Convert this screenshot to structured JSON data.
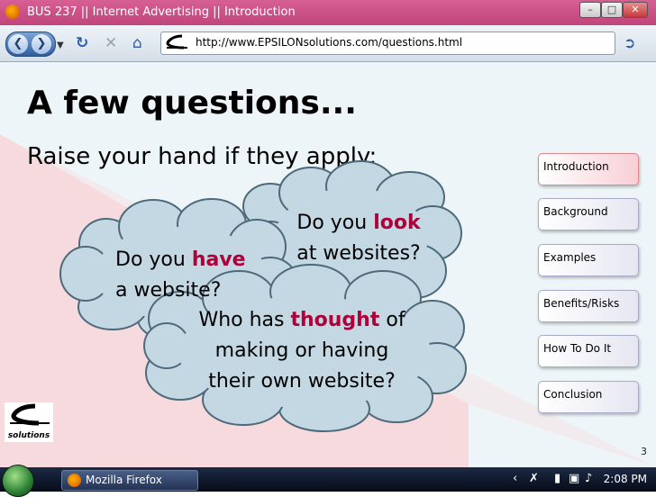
{
  "window": {
    "title": "BUS 237 || Internet Advertising || Introduction",
    "minimize_icon": "minimize-icon",
    "maximize_icon": "maximize-icon",
    "close_icon": "close-icon"
  },
  "toolbar": {
    "url": "http://www.EPSILONsolutions.com/questions.html"
  },
  "slide": {
    "heading": "A few questions...",
    "subheading": "Raise your hand if they apply:",
    "cloud1": {
      "before": "Do you ",
      "highlight": "look",
      "after": "at websites?"
    },
    "cloud2": {
      "before": "Do you ",
      "highlight": "have",
      "after": "a website?"
    },
    "cloud3": {
      "before": "Who has ",
      "highlight": "thought",
      "after1": " of",
      "line2": "making or having",
      "line3": "their own website?"
    },
    "highlight_color": "#b0003a",
    "logo_text": "solutions",
    "slide_number": "3"
  },
  "nav": [
    {
      "label": "Introduction",
      "active": true
    },
    {
      "label": "Background",
      "active": false
    },
    {
      "label": "Examples",
      "active": false
    },
    {
      "label": "Benefits/Risks",
      "active": false
    },
    {
      "label": "How To Do It",
      "active": false
    },
    {
      "label": "Conclusion",
      "active": false
    }
  ],
  "taskbar": {
    "app_label": "Mozilla Firefox",
    "time": "2:08 PM"
  }
}
